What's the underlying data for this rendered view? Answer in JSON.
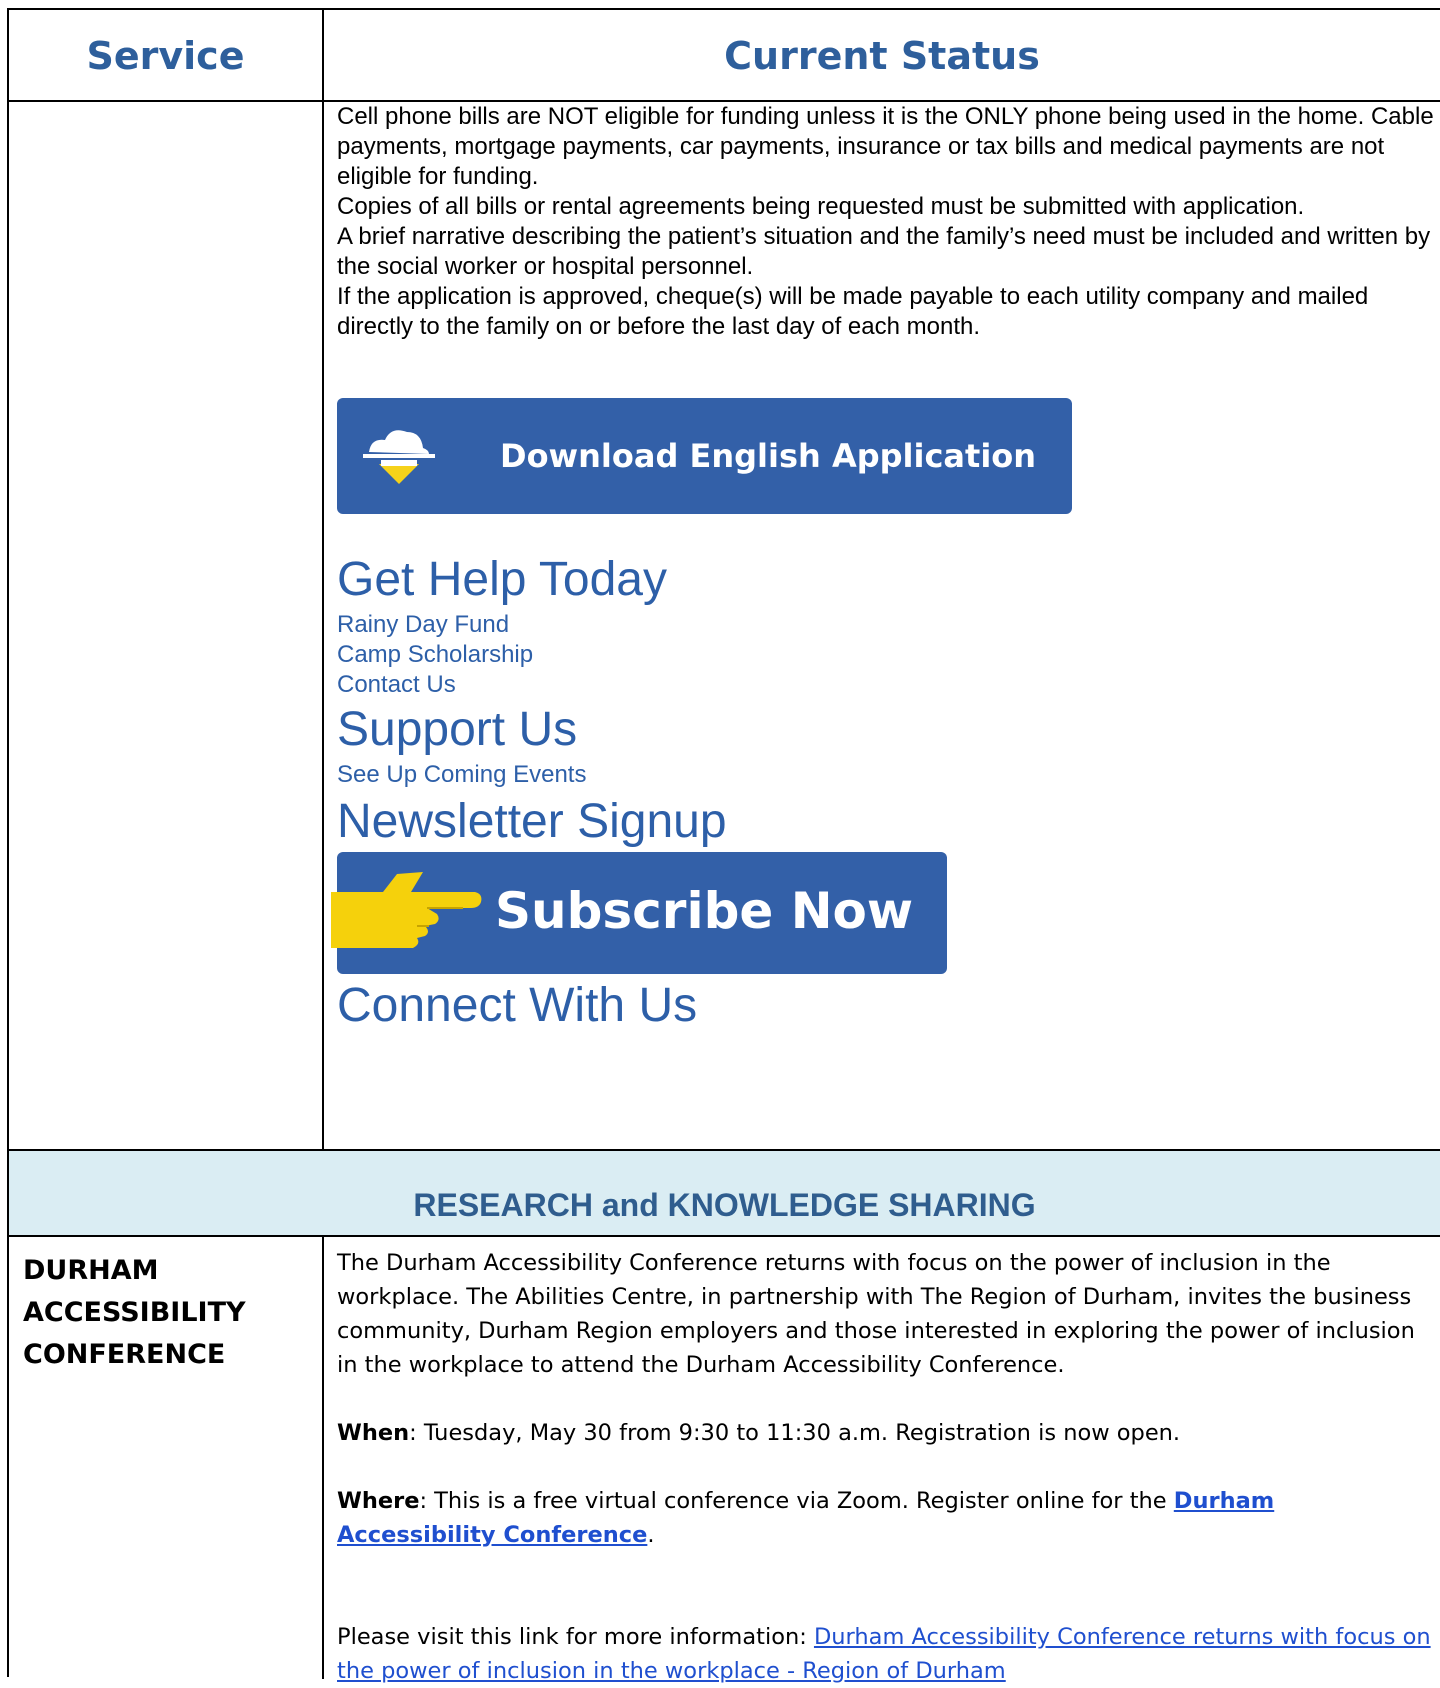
{
  "table": {
    "headers": {
      "service": "Service",
      "status": "Current Status"
    }
  },
  "utility": {
    "paragraphs": [
      "Cell phone bills are NOT eligible for funding unless it is the ONLY phone being used in the home. Cable payments, mortgage payments, car payments, insurance or tax bills and medical payments are not eligible for funding.",
      "Copies of all bills or rental agreements being requested must be submitted with application.",
      "A brief narrative describing the patient’s situation and the family’s need must be included and written by the social worker or hospital personnel.",
      "If the application is approved, cheque(s) will be made payable to each utility company and mailed directly to the family on or before the last day of each month."
    ],
    "download_button": {
      "label": "Download English Application",
      "icon": "cloud-download-icon"
    },
    "get_help": {
      "heading": "Get Help Today",
      "links": [
        "Rainy Day Fund",
        "Camp Scholarship",
        "Contact Us"
      ]
    },
    "support": {
      "heading": "Support Us",
      "links": [
        "See Up Coming Events"
      ]
    },
    "newsletter": {
      "heading": "Newsletter Signup"
    },
    "subscribe_button": {
      "label": "Subscribe Now",
      "icon": "pointing-hand-icon"
    },
    "connect": {
      "heading": "Connect With Us"
    }
  },
  "section": {
    "title": "RESEARCH and KNOWLEDGE SHARING"
  },
  "conference": {
    "service_name": "DURHAM ACCESSIBILITY CONFERENCE",
    "intro": "The Durham Accessibility Conference returns with focus on the power of inclusion in the workplace. The Abilities Centre, in partnership with The Region of Durham, invites the business community, Durham Region employers and those interested in exploring the power of inclusion in the workplace to attend the Durham Accessibility Conference.",
    "when_label": "When",
    "when_text": ": Tuesday, May 30 from 9:30 to 11:30 a.m. Registration is now open.",
    "where_label": "Where",
    "where_text": ": This is a free virtual conference via Zoom. Register online for the ",
    "where_link": "Durham Accessibility Conference",
    "where_end": ".",
    "more_text": "Please visit this link for more information: ",
    "more_link": "Durham Accessibility Conference returns with focus on the power of inclusion in the workplace - Region of Durham"
  },
  "colors": {
    "header_text": "#2e5f9c",
    "link_blue": "#2d5fa8",
    "button_blue": "#3360a8",
    "section_band": "#daedf3",
    "hyperlink": "#1f4fcf"
  }
}
